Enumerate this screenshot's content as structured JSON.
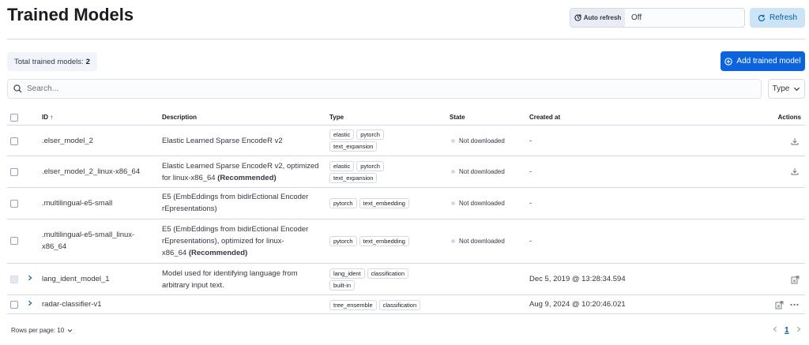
{
  "page": {
    "title": "Trained Models"
  },
  "toolbar": {
    "auto_refresh_label": "Auto refresh",
    "auto_refresh_value": "Off",
    "refresh_label": "Refresh",
    "add_label": "Add trained model"
  },
  "summary": {
    "total_label": "Total trained models:",
    "total_value": "2"
  },
  "search": {
    "placeholder": "Search..."
  },
  "filter": {
    "type_label": "Type"
  },
  "table": {
    "headers": {
      "id": "ID",
      "description": "Description",
      "type": "Type",
      "state": "State",
      "created": "Created at",
      "actions": "Actions"
    },
    "rows": [
      {
        "id": ".elser_model_2",
        "desc1": "Elastic Learned Sparse EncodeR v2",
        "desc2": "",
        "desc3": "",
        "bold": "",
        "tags": [
          "elastic",
          "pytorch",
          "text_expansion"
        ],
        "state": "Not downloaded",
        "created": "-"
      },
      {
        "id": ".elser_model_2_linux-x86_64",
        "desc1": "Elastic Learned Sparse EncodeR v2, optimized",
        "desc2": "for linux-x86_64 ",
        "desc3": "",
        "bold": "(Recommended)",
        "tags": [
          "elastic",
          "pytorch",
          "text_expansion"
        ],
        "state": "Not downloaded",
        "created": "-"
      },
      {
        "id": ".multilingual-e5-small",
        "desc1": "E5 (EmbEddings from bidirEctional Encoder",
        "desc2": "rEpresentations)",
        "desc3": "",
        "bold": "",
        "tags": [
          "pytorch",
          "text_embedding"
        ],
        "state": "Not downloaded",
        "created": "-"
      },
      {
        "id1": ".multilingual-e5-small_linux-",
        "id2": "x86_64",
        "desc1": "E5 (EmbEddings from bidirEctional Encoder",
        "desc2": "rEpresentations), optimized for linux-",
        "desc3": "x86_64 ",
        "bold": "(Recommended)",
        "tags": [
          "pytorch",
          "text_embedding"
        ],
        "state": "Not downloaded",
        "created": "-"
      },
      {
        "id": "lang_ident_model_1",
        "desc1": "Model used for identifying language from",
        "desc2": "arbitrary input text.",
        "tags": [
          "lang_ident",
          "classification",
          "built-in"
        ],
        "created": "Dec 5, 2019 @ 13:28:34.594"
      },
      {
        "id": "radar-classifier-v1",
        "desc1": "",
        "tags": [
          "tree_ensemble",
          "classification"
        ],
        "created": "Aug 9, 2024 @ 10:20:46.021"
      }
    ]
  },
  "footer": {
    "rows_per_page": "Rows per page: 10",
    "page": "1"
  },
  "colors": {
    "primary": "#0b64dd",
    "refresh_bg": "#cce4f5",
    "border": "#d3dae6"
  }
}
